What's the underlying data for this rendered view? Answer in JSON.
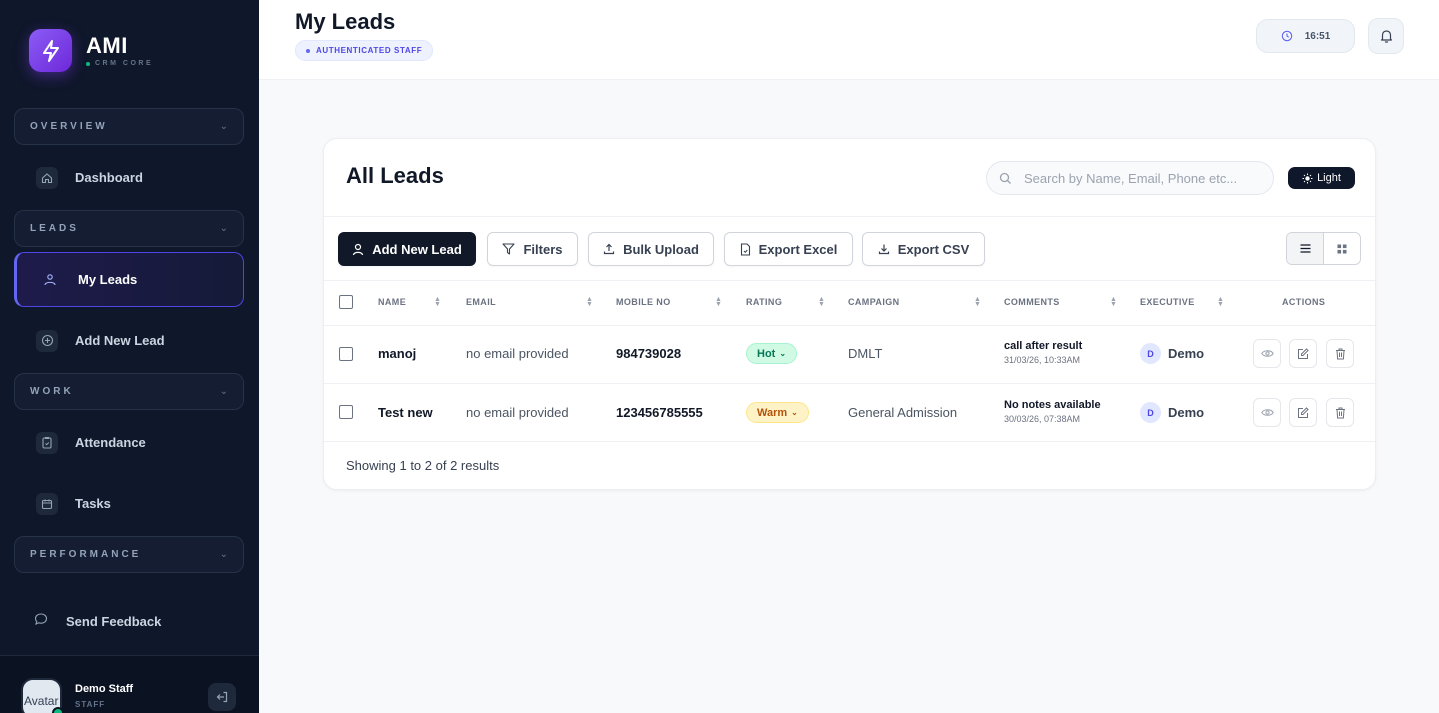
{
  "brand": {
    "name": "AMI",
    "subtitle": "CRM CORE"
  },
  "sidebar": {
    "groups": [
      {
        "label": "OVERVIEW"
      },
      {
        "label": "LEADS"
      },
      {
        "label": "WORK"
      },
      {
        "label": "PERFORMANCE"
      }
    ],
    "items": [
      {
        "label": "Dashboard",
        "icon": "home-icon"
      },
      {
        "label": "My Leads",
        "icon": "users-icon",
        "active": true
      },
      {
        "label": "Add New Lead",
        "icon": "plus-circle-icon"
      },
      {
        "label": "Attendance",
        "icon": "clipboard-icon"
      },
      {
        "label": "Tasks",
        "icon": "calendar-icon"
      }
    ],
    "feedback": {
      "label": "Send Feedback",
      "icon": "message-icon"
    }
  },
  "user": {
    "name": "Demo Staff",
    "role": "STAFF",
    "avatar_alt": "Avatar"
  },
  "header": {
    "title": "My Leads",
    "badge": "AUTHENTICATED STAFF",
    "time": "16:51"
  },
  "card": {
    "title": "All Leads",
    "search_placeholder": "Search by Name, Email, Phone etc...",
    "theme_toggle": "Light"
  },
  "toolbar": {
    "add": "Add New Lead",
    "filters": "Filters",
    "bulk_upload": "Bulk Upload",
    "export_excel": "Export Excel",
    "export_csv": "Export CSV"
  },
  "table": {
    "columns": [
      "NAME",
      "EMAIL",
      "MOBILE NO",
      "RATING",
      "CAMPAIGN",
      "COMMENTS",
      "EXECUTIVE",
      "ACTIONS"
    ],
    "rows": [
      {
        "name": "manoj",
        "email": "no email provided",
        "mobile": "984739028",
        "rating": "Hot",
        "campaign": "DMLT",
        "comment": "call after result",
        "comment_date": "31/03/26, 10:33AM",
        "executive_initial": "D",
        "executive": "Demo"
      },
      {
        "name": "Test new",
        "email": "no email provided",
        "mobile": "123456785555",
        "rating": "Warm",
        "campaign": "General Admission",
        "comment": "No notes available",
        "comment_date": "30/03/26, 07:38AM",
        "executive_initial": "D",
        "executive": "Demo"
      }
    ],
    "footer": "Showing 1 to 2 of 2 results"
  },
  "colors": {
    "accent": "#7c3aed",
    "sidebar_bg": "#0f172a",
    "primary_button": "#111827",
    "hot": "#047857",
    "warm": "#b45309"
  }
}
